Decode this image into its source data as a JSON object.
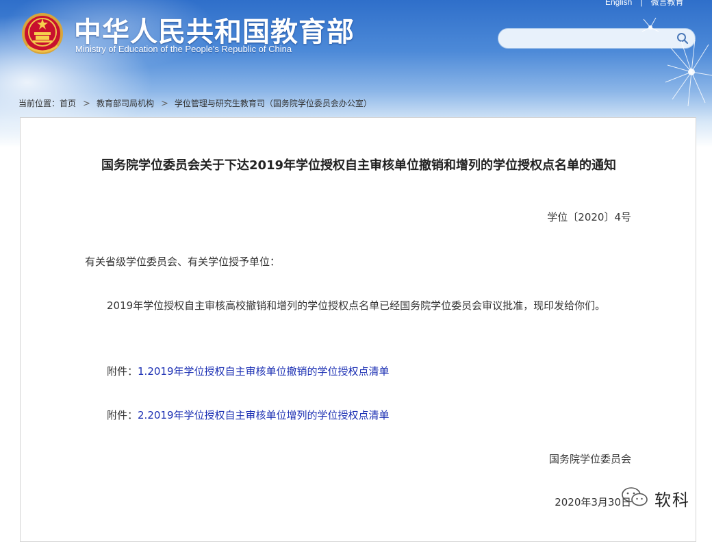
{
  "header": {
    "title_cn": "中华人民共和国教育部",
    "title_en": "Ministry of Education of the People's Republic of China",
    "links": [
      "English",
      "微言教育"
    ],
    "search": {
      "placeholder": ""
    }
  },
  "breadcrumb": {
    "prefix": "当前位置：",
    "items": [
      "首页",
      "教育部司局机构",
      "学位管理与研究生教育司（国务院学位委员会办公室）"
    ]
  },
  "document": {
    "title": "国务院学位委员会关于下达2019年学位授权自主审核单位撤销和增列的学位授权点名单的通知",
    "doc_number": "学位〔2020〕4号",
    "salutation": "有关省级学位委员会、有关学位授予单位：",
    "body": "2019年学位授权自主审核高校撤销和增列的学位授权点名单已经国务院学位委员会审议批准，现印发给你们。",
    "attachments": [
      {
        "prefix": "附件：",
        "num": "1.",
        "link": "2019年学位授权自主审核单位撤销的学位授权点清单"
      },
      {
        "prefix": "附件：",
        "num": "2.",
        "link": "2019年学位授权自主审核单位增列的学位授权点清单"
      }
    ],
    "signature": "国务院学位委员会",
    "date": "2020年3月30日"
  },
  "watermark": {
    "text": "软科"
  },
  "colors": {
    "banner": "#4d8ad8",
    "link": "#1b2fb3"
  }
}
